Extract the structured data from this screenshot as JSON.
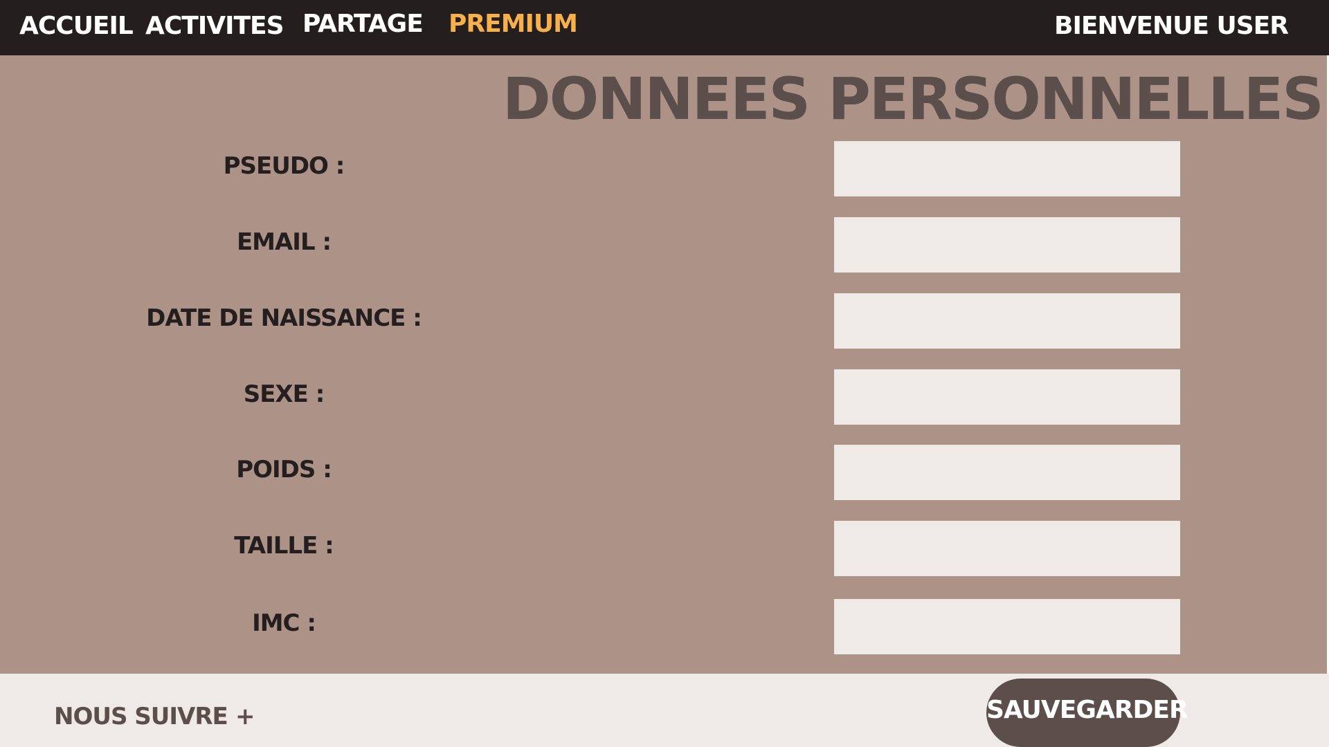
{
  "nav": {
    "items": [
      {
        "label": "ACCUEIL",
        "color": "#ffffff"
      },
      {
        "label": "ACTIVITES",
        "color": "#ffffff"
      },
      {
        "label": "PARTAGE",
        "color": "#ffffff"
      },
      {
        "label": "PREMIUM",
        "color": "#f8b04b"
      }
    ],
    "welcome": "BIENVENUE USER"
  },
  "page": {
    "title": "DONNEES PERSONNELLES"
  },
  "form": {
    "fields": [
      {
        "label": "PSEUDO :",
        "value": ""
      },
      {
        "label": "EMAIL :",
        "value": ""
      },
      {
        "label": "DATE DE NAISSANCE :",
        "value": ""
      },
      {
        "label": "SEXE :",
        "value": ""
      },
      {
        "label": "POIDS :",
        "value": ""
      },
      {
        "label": "TAILLE :",
        "value": ""
      },
      {
        "label": "IMC :",
        "value": ""
      }
    ]
  },
  "footer": {
    "follow_label": "NOUS SUIVRE",
    "plus_glyph": "+",
    "save_label": "SAUVEGARDER"
  },
  "colors": {
    "nav_background": "#251e1f",
    "main_background": "#ad9387",
    "title_text": "#5b4e4b",
    "input_background": "#efeae6",
    "premium_accent": "#f8b04b",
    "button_background": "#5b4e4b"
  }
}
